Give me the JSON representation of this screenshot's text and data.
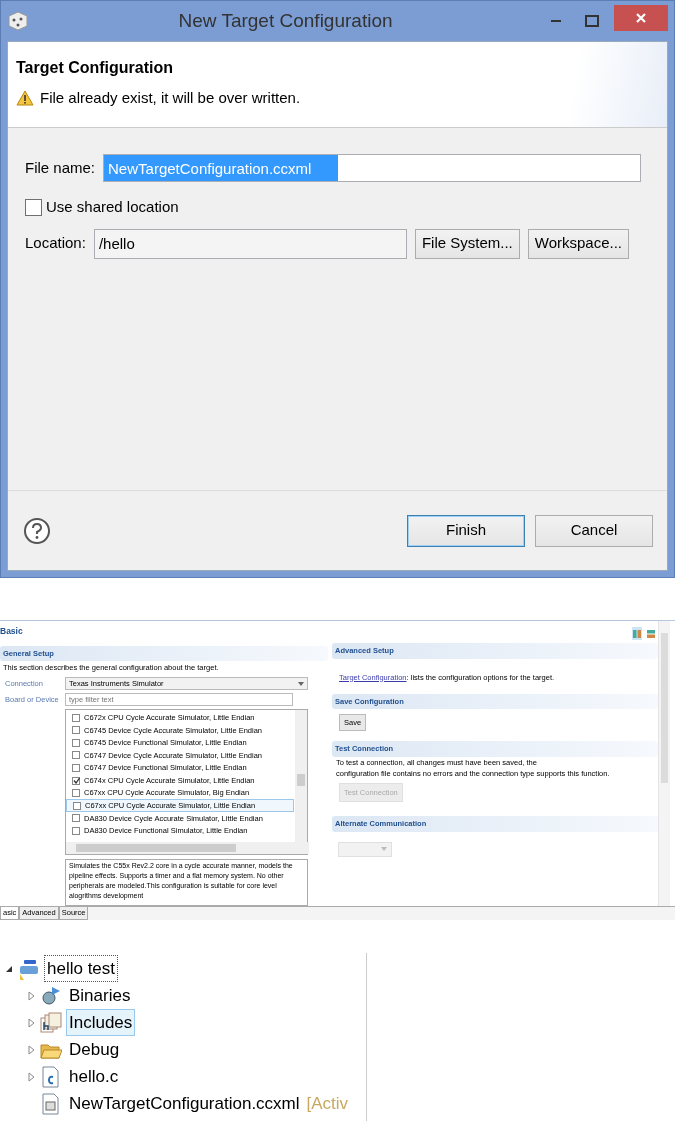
{
  "dialog": {
    "title": "New Target Configuration",
    "header_title": "Target Configuration",
    "message": "File already exist, it will be over written.",
    "file_name": {
      "label": "File name:",
      "value": "NewTargetConfiguration.ccxml"
    },
    "use_shared_location": {
      "label": "Use shared location",
      "checked": false
    },
    "location": {
      "label": "Location:",
      "value": "/hello"
    },
    "location_buttons": [
      "File System...",
      "Workspace..."
    ],
    "buttons": [
      {
        "label": "Finish",
        "default": true
      },
      {
        "label": "Cancel",
        "default": false
      }
    ]
  },
  "editor": {
    "title": "Basic",
    "general_setup": {
      "heading": "General Setup",
      "description": "This section describes the general configuration about the target.",
      "connection": {
        "label": "Connection",
        "value": "Texas Instruments Simulator"
      },
      "board": {
        "label": "Board or Device",
        "placeholder": "type filter text"
      },
      "devices": [
        {
          "label": "C672x CPU Cycle Accurate Simulator, Little Endian",
          "checked": false,
          "selected": false
        },
        {
          "label": "C6745 Device Cycle Accurate Simulator, Little Endian",
          "checked": false,
          "selected": false
        },
        {
          "label": "C6745 Device Functional Simulator, Little Endian",
          "checked": false,
          "selected": false
        },
        {
          "label": "C6747 Device Cycle Accurate Simulator, Little Endian",
          "checked": false,
          "selected": false
        },
        {
          "label": "C6747 Device Functional Simulator, Little Endian",
          "checked": false,
          "selected": false
        },
        {
          "label": "C674x CPU Cycle Accurate Simulator, Little Endian",
          "checked": true,
          "selected": false
        },
        {
          "label": "C67xx CPU Cycle Accurate Simulator, Big Endian",
          "checked": false,
          "selected": false
        },
        {
          "label": "C67xx CPU Cycle Accurate Simulator, Little Endian",
          "checked": false,
          "selected": true
        },
        {
          "label": "DA830 Device Cycle Accurate Simulator, Little Endian",
          "checked": false,
          "selected": false
        },
        {
          "label": "DA830 Device Functional Simulator, Little Endian",
          "checked": false,
          "selected": false
        }
      ],
      "details": "Simulates the C55x Rev2.2 core in a cycle accurate manner, models the pipeline effects. Supports a timer and a flat memory system. No other peripherals are modeled.This configuration is suitable for core level alogrithms development"
    },
    "advanced_setup": {
      "heading": "Advanced Setup",
      "link": "Target Configuration",
      "text": ": lists the configuration options for the target."
    },
    "save_configuration": {
      "heading": "Save Configuration",
      "button": "Save"
    },
    "test_connection": {
      "heading": "Test Connection",
      "lines": [
        "To test a connection, all changes must have been saved, the",
        "configuration file contains no errors and the connection type supports this function."
      ],
      "button": {
        "label": "Test Connection",
        "disabled": true
      }
    },
    "alternate_communication": {
      "heading": "Alternate Communication"
    },
    "tabs": [
      {
        "label": "asic",
        "selected": true
      },
      {
        "label": "Advanced",
        "selected": false
      },
      {
        "label": "Source",
        "selected": false
      }
    ]
  },
  "project_tree": {
    "label": "hello test",
    "kind": "project",
    "expanded": true,
    "children": [
      {
        "label": "Binaries",
        "kind": "binaries",
        "expanded": false,
        "selected": false
      },
      {
        "label": "Includes",
        "kind": "includes",
        "expanded": false,
        "selected": true
      },
      {
        "label": "Debug",
        "kind": "folder",
        "expanded": false,
        "selected": false
      },
      {
        "label": "hello.c",
        "kind": "cfile",
        "expanded": false,
        "selected": false
      },
      {
        "label": "NewTargetConfiguration.ccxml",
        "kind": "xmlfile",
        "decoration": "[Activ",
        "selected": false
      }
    ]
  }
}
